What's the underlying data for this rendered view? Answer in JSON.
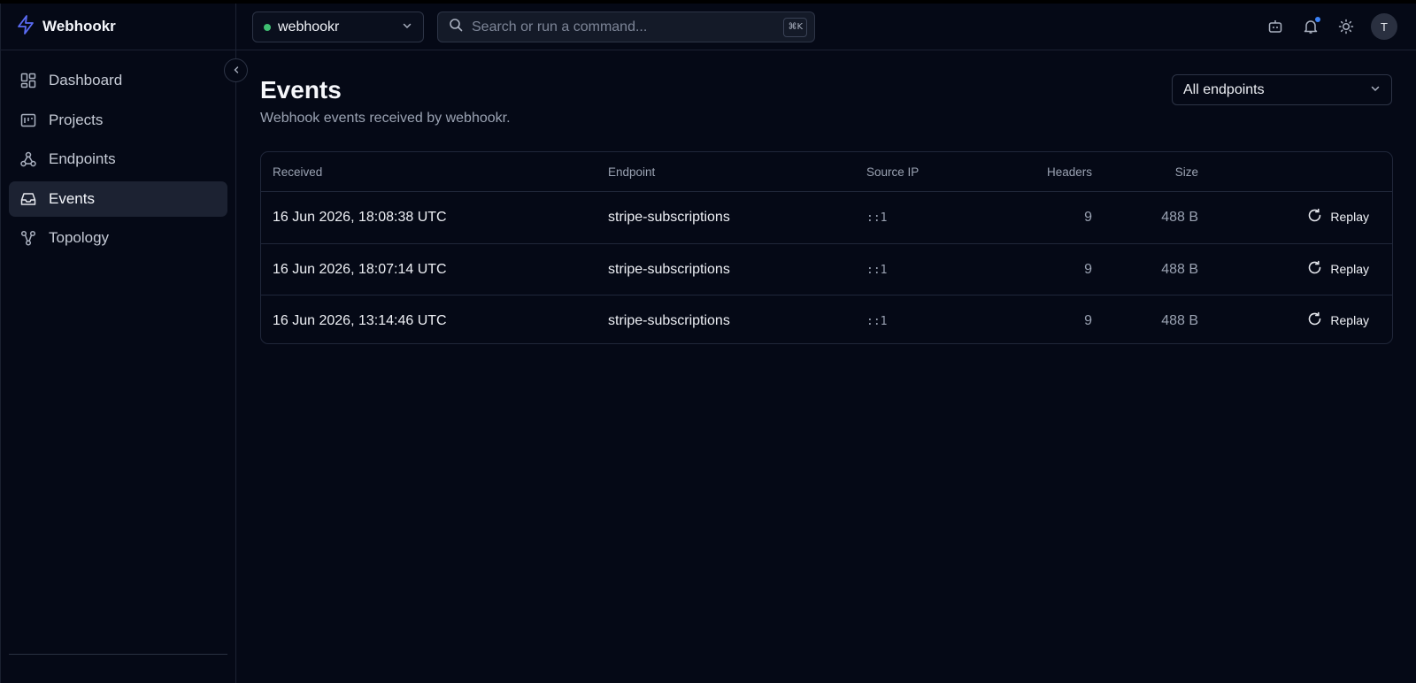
{
  "brand": {
    "name": "Webhookr"
  },
  "sidebar": {
    "items": [
      {
        "label": "Dashboard",
        "icon": "dashboard-icon"
      },
      {
        "label": "Projects",
        "icon": "projects-icon"
      },
      {
        "label": "Endpoints",
        "icon": "webhook-icon"
      },
      {
        "label": "Events",
        "icon": "inbox-icon",
        "active": true
      },
      {
        "label": "Topology",
        "icon": "topology-icon"
      }
    ]
  },
  "topbar": {
    "project": {
      "name": "webhookr",
      "status_color": "#3fbf72"
    },
    "search": {
      "placeholder": "Search or run a command...",
      "shortcut": "⌘K"
    },
    "avatar_initial": "T",
    "notification_dot_color": "#3b82f6"
  },
  "page": {
    "title": "Events",
    "subtitle": "Webhook events received by webhookr.",
    "filter": {
      "selected": "All endpoints"
    }
  },
  "table": {
    "columns": [
      "Received",
      "Endpoint",
      "Source IP",
      "Headers",
      "Size"
    ],
    "rows": [
      {
        "received": "16 Jun 2026, 18:08:38 UTC",
        "endpoint": "stripe-subscriptions",
        "source_ip": "::1",
        "headers": "9",
        "size": "488 B",
        "action": "Replay"
      },
      {
        "received": "16 Jun 2026, 18:07:14 UTC",
        "endpoint": "stripe-subscriptions",
        "source_ip": "::1",
        "headers": "9",
        "size": "488 B",
        "action": "Replay"
      },
      {
        "received": "16 Jun 2026, 13:14:46 UTC",
        "endpoint": "stripe-subscriptions",
        "source_ip": "::1",
        "headers": "9",
        "size": "488 B",
        "action": "Replay"
      }
    ]
  },
  "colors": {
    "accent": "#5b6cf5",
    "background": "#050916"
  }
}
